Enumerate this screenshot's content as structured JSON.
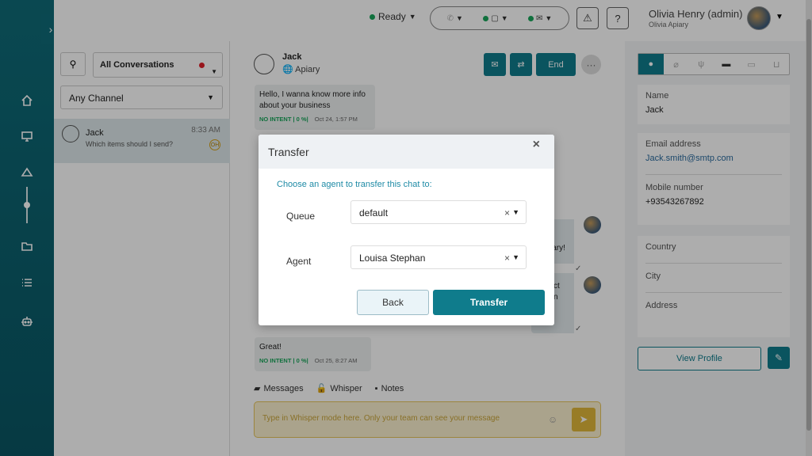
{
  "topbar": {
    "status": "Ready",
    "user_name": "Olivia Henry (admin)",
    "user_org": "Olivia Apiary"
  },
  "conversations": {
    "filter": "All Conversations",
    "channel_filter": "Any Channel",
    "items": [
      {
        "name": "Jack",
        "time": "8:33 AM",
        "preview": "Which items should I send?",
        "badge": "OH"
      }
    ]
  },
  "chat": {
    "contact_name": "Jack",
    "contact_org": "Apiary",
    "end_label": "End",
    "messages": [
      {
        "text": "Hello, I wanna know more info about your business",
        "intent": "NO INTENT | 0 %|",
        "time": "Oct 24, 1:57 PM"
      },
      {
        "text": "Great!",
        "intent": "NO INTENT | 0 %|",
        "time": "Oct 25, 8:27 AM"
      }
    ],
    "partial_agent_text_1": "iary!",
    "partial_agent_text_2a": "ct",
    "partial_agent_text_2b": "n",
    "tabs": {
      "messages": "Messages",
      "whisper": "Whisper",
      "notes": "Notes"
    },
    "whisper_placeholder": "Type in Whisper mode here. Only your team can see your message"
  },
  "profile": {
    "name_label": "Name",
    "name_value": "Jack",
    "email_label": "Email address",
    "email_value": "Jack.smith@smtp.com",
    "mobile_label": "Mobile number",
    "mobile_value": "+93543267892",
    "country_label": "Country",
    "city_label": "City",
    "address_label": "Address",
    "view_profile": "View Profile"
  },
  "modal": {
    "title": "Transfer",
    "subtitle": "Choose an agent to transfer this chat to:",
    "queue_label": "Queue",
    "queue_value": "default",
    "agent_label": "Agent",
    "agent_value": "Louisa Stephan",
    "back_label": "Back",
    "transfer_label": "Transfer"
  },
  "colors": {
    "accent": "#0f7c8c",
    "rail": "#0f6b78",
    "online": "#19a55a",
    "whisper": "#fbf1cf"
  }
}
